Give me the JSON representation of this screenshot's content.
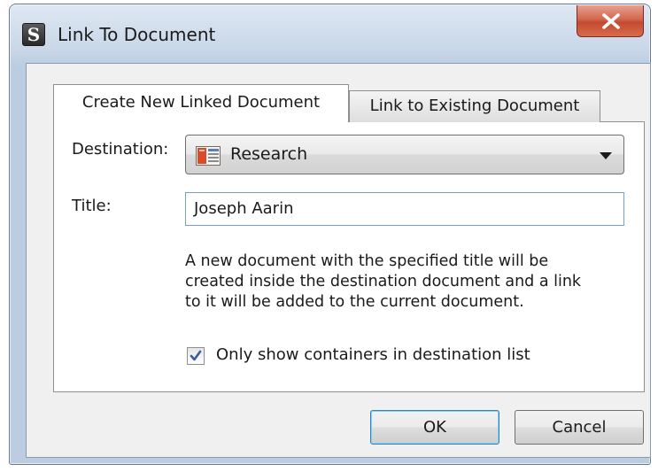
{
  "window": {
    "title": "Link To Document",
    "app_icon_letter": "S",
    "close_icon": "close-x-icon"
  },
  "tabs": [
    {
      "label": "Create New Linked Document",
      "active": true
    },
    {
      "label": "Link to Existing Document",
      "active": false
    }
  ],
  "form": {
    "destination_label": "Destination:",
    "destination_value": "Research",
    "destination_icon": "binder-document-icon",
    "title_label": "Title:",
    "title_value": "Joseph Aarin",
    "description_lines": [
      "A new document with the specified title will be",
      "created inside the destination document and a link",
      "to it will be added to the current document."
    ],
    "checkbox_label": "Only show containers in destination list",
    "checkbox_checked": true
  },
  "buttons": {
    "ok": "OK",
    "cancel": "Cancel"
  },
  "colors": {
    "close_button": "#c44a31",
    "input_border": "#7a9ec6",
    "default_button_border": "#3c7fb1",
    "checkmark": "#3a5f9e"
  }
}
